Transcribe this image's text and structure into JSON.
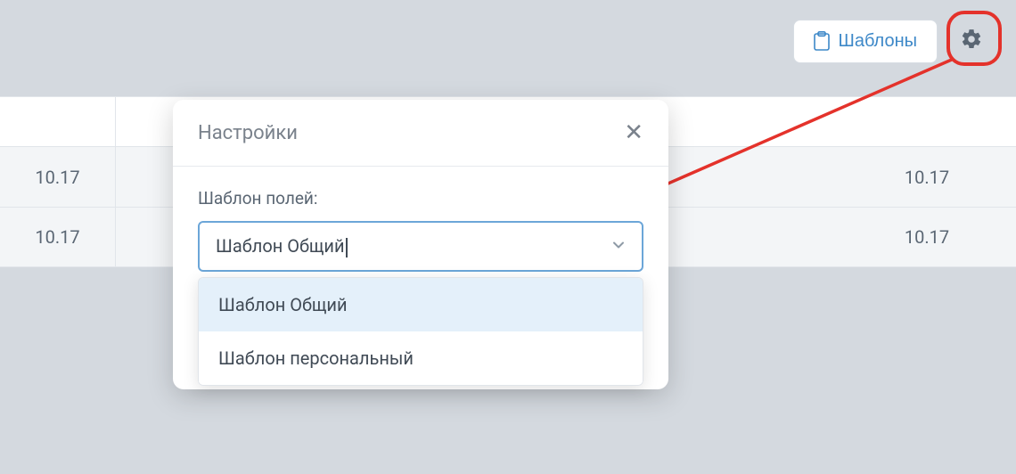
{
  "topbar": {
    "templates_button": "Шаблоны"
  },
  "table": {
    "rows": [
      {
        "left": "10.17",
        "right": "10.17"
      },
      {
        "left": "10.17",
        "right": "10.17"
      }
    ]
  },
  "modal": {
    "title": "Настройки",
    "field_label": "Шаблон полей:",
    "selected_value": "Шаблон Общий",
    "options": [
      "Шаблон Общий",
      "Шаблон персональный"
    ]
  }
}
